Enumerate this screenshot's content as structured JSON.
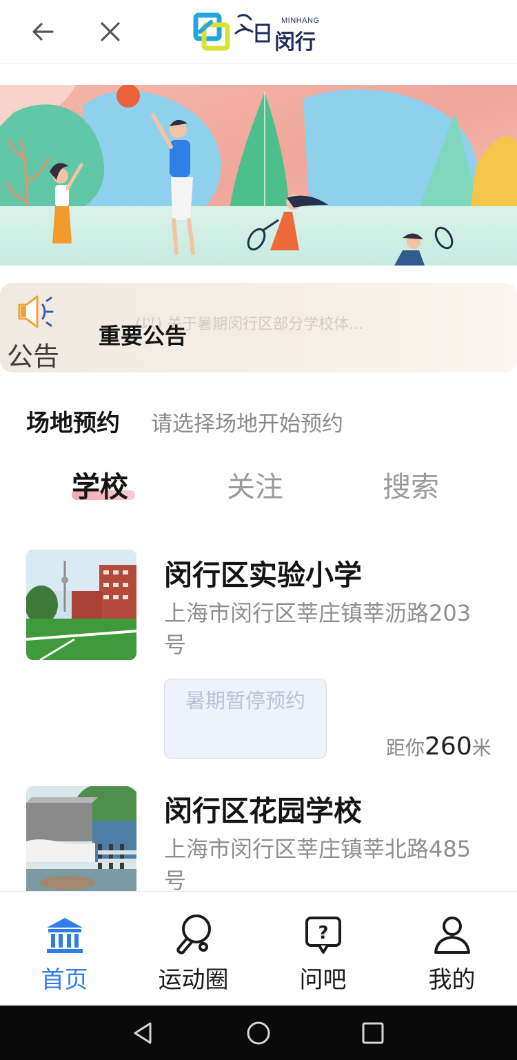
{
  "header": {
    "logo_brand_cn": "今日闵行",
    "logo_latin": "MINHANG",
    "logo_main": "闵行"
  },
  "notice": {
    "label": "公告",
    "title": "重要公告",
    "scroll_text": "(以) 关于暑期闵行区部分学校体..."
  },
  "section": {
    "title": "场地预约",
    "hint": "请选择场地开始预约"
  },
  "tabs": [
    {
      "label": "学校",
      "active": true
    },
    {
      "label": "关注",
      "active": false
    },
    {
      "label": "搜索",
      "active": false
    }
  ],
  "schools": [
    {
      "name": "闵行区实验小学",
      "address": "上海市闵行区莘庄镇莘沥路203号",
      "status": "暑期暂停预约",
      "distance_prefix": "距你",
      "distance_value": "260",
      "distance_unit": "米"
    },
    {
      "name": "闵行区花园学校",
      "address": "上海市闵行区莘庄镇莘北路485号"
    }
  ],
  "bottom_nav": [
    {
      "label": "首页",
      "icon": "bank-icon",
      "active": true
    },
    {
      "label": "运动圈",
      "icon": "ping-pong-icon",
      "active": false
    },
    {
      "label": "问吧",
      "icon": "question-bubble-icon",
      "active": false
    },
    {
      "label": "我的",
      "icon": "user-icon",
      "active": false
    }
  ],
  "colors": {
    "accent": "#2f7ee6",
    "tab_underline": "#f3a8b2",
    "status_bg": "#edf2fb",
    "notice_bg": "#f3ede6"
  }
}
